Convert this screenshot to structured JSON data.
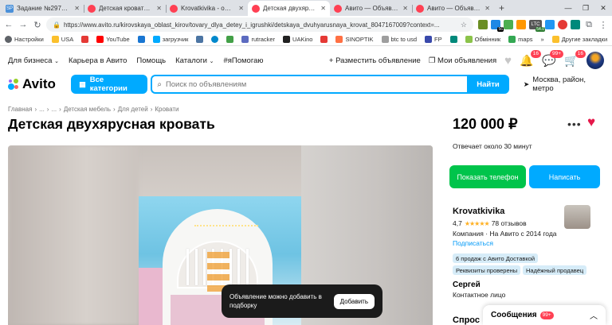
{
  "browser": {
    "tabs": [
      {
        "title": "Задание №2974357 - п",
        "favicon": "sp-icon",
        "color": "#4a90d9",
        "active": false
      },
      {
        "title": "Детская кровать черда",
        "favicon": "avito-icon",
        "color": "#ff4053",
        "active": false
      },
      {
        "title": "Krovatkivika - официал",
        "favicon": "avito-icon",
        "color": "#ff4053",
        "active": false
      },
      {
        "title": "Детская двухярусная кр",
        "favicon": "avito-icon",
        "color": "#ff4053",
        "active": true
      },
      {
        "title": "Авито — Объявления н",
        "favicon": "avito-icon",
        "color": "#ff4053",
        "active": false
      },
      {
        "title": "Авито — Объявления н",
        "favicon": "avito-icon",
        "color": "#ff4053",
        "active": false
      }
    ],
    "url": "https://www.avito.ru/kirovskaya_oblast_kirov/tovary_dlya_detey_i_igrushki/detskaya_dvuhyarusnaya_krovat_804716700​9?context=...",
    "extensions": [
      {
        "name": "ext-icon",
        "label": "",
        "color": "#6b8e23",
        "badge": ""
      },
      {
        "name": "ext-icon",
        "label": "",
        "color": "#1e88e5",
        "badge": "56"
      },
      {
        "name": "ext-icon",
        "label": "",
        "color": "#4caf50",
        "badge": ""
      },
      {
        "name": "ext-icon",
        "label": "",
        "color": "#ff9800",
        "badge": ""
      },
      {
        "name": "ltc-icon",
        "label": "LTC",
        "color": "#555555",
        "badge": "54.0"
      },
      {
        "name": "ext-icon",
        "label": "",
        "color": "#2196f3",
        "badge": ""
      },
      {
        "name": "ext-icon",
        "label": "",
        "color": "#e53935",
        "badge": ""
      },
      {
        "name": "ext-icon",
        "label": "",
        "color": "#00897b",
        "badge": ""
      }
    ],
    "bookmarks": [
      {
        "label": "Настройки",
        "color": "#5f6368"
      },
      {
        "label": "USA",
        "color": "#3f51b5"
      },
      {
        "label": "",
        "color": "#e53935"
      },
      {
        "label": "YouTube",
        "color": "#ff0000"
      },
      {
        "label": "",
        "color": "#1976d2"
      },
      {
        "label": "загрузчик",
        "color": "#00aaff"
      },
      {
        "label": "",
        "color": "#4c75a3"
      },
      {
        "label": "",
        "color": "#0088cc"
      },
      {
        "label": "",
        "color": "#43a047"
      },
      {
        "label": "rutracker",
        "color": "#5c6bc0"
      },
      {
        "label": "UAKino",
        "color": "#212121"
      },
      {
        "label": "",
        "color": "#e53935"
      },
      {
        "label": "SINOPTIK",
        "color": "#ff7043"
      },
      {
        "label": "btc to usd",
        "color": "#9e9e9e"
      },
      {
        "label": "FP",
        "color": "#3949ab"
      },
      {
        "label": "",
        "color": "#00897b"
      },
      {
        "label": "Обмінник",
        "color": "#8bc34a"
      },
      {
        "label": "maps",
        "color": "#34a853"
      }
    ],
    "bookmarks_right": "Другие закладки"
  },
  "nav": {
    "business": "Для бизнеса",
    "career": "Карьера в Авито",
    "help": "Помощь",
    "catalogs": "Каталоги",
    "hashtag": "#яПомогаю",
    "post_ad": "Разместить объявление",
    "my_ads": "Мои объявления",
    "fav_count": "",
    "msg_count": "16",
    "notif_count": "99+",
    "cart_count": "16"
  },
  "search": {
    "logo": "Avito",
    "categories": "Все категории",
    "placeholder": "Поиск по объявлениям",
    "submit": "Найти",
    "location": "Москва, район, метро"
  },
  "breadcrumbs": [
    "Главная",
    "›",
    "...",
    "›",
    "...",
    "›",
    "Детская мебель",
    "›",
    "Для детей",
    "›",
    "Кровати"
  ],
  "listing": {
    "title": "Детская двухярусная кровать",
    "price": "120 000 ₽",
    "reply_time": "Отвечает около 30 минут",
    "show_phone": "Показать телефон",
    "write": "Написать"
  },
  "seller": {
    "name": "Krovatkivika",
    "rating": "4,7",
    "stars": "★★★★★",
    "reviews": "78 отзывов",
    "company": "Компания · На Авито с 2014 года",
    "subscribe": "Подписаться",
    "tags": [
      "6 продаж с Авито Доставкой",
      "Реквизиты проверены",
      "Надёжный продавец"
    ],
    "contact_name": "Сергей",
    "contact_role": "Контактное лицо"
  },
  "toast": {
    "text": "Объявление можно добавить в подборку",
    "button": "Добавить"
  },
  "ask_heading": "Спрос",
  "messages": {
    "label": "Сообщения",
    "count": "99+"
  },
  "colors": {
    "accent": "#00aaff",
    "green": "#00c44b",
    "badge": "#ff4053",
    "heart": "#e5184a"
  }
}
